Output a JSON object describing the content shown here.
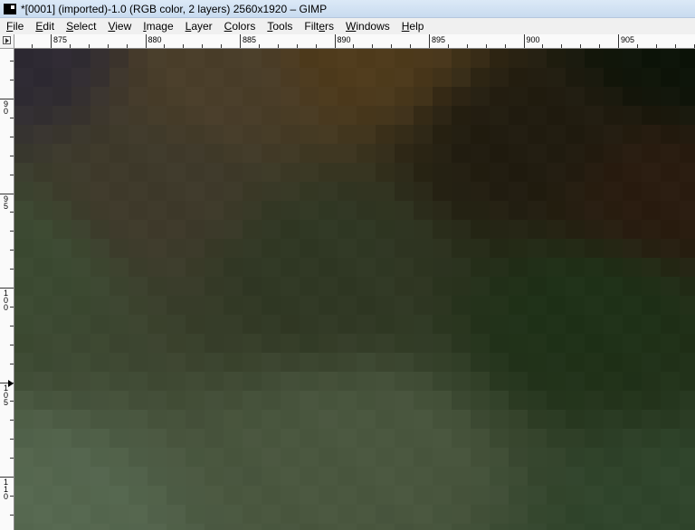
{
  "window": {
    "title": "*[0001] (imported)-1.0 (RGB color, 2 layers) 2560x1920 – GIMP"
  },
  "menu": [
    {
      "pre": "",
      "ul": "F",
      "post": "ile",
      "name": "file"
    },
    {
      "pre": "",
      "ul": "E",
      "post": "dit",
      "name": "edit"
    },
    {
      "pre": "",
      "ul": "S",
      "post": "elect",
      "name": "select"
    },
    {
      "pre": "",
      "ul": "V",
      "post": "iew",
      "name": "view"
    },
    {
      "pre": "",
      "ul": "I",
      "post": "mage",
      "name": "image"
    },
    {
      "pre": "",
      "ul": "L",
      "post": "ayer",
      "name": "layer"
    },
    {
      "pre": "",
      "ul": "C",
      "post": "olors",
      "name": "colors"
    },
    {
      "pre": "",
      "ul": "T",
      "post": "ools",
      "name": "tools"
    },
    {
      "pre": "Filt",
      "ul": "e",
      "post": "rs",
      "name": "filters"
    },
    {
      "pre": "",
      "ul": "W",
      "post": "indows",
      "name": "windows"
    },
    {
      "pre": "",
      "ul": "H",
      "post": "elp",
      "name": "help"
    }
  ],
  "rulers": {
    "horizontal_labels": [
      "875",
      "880",
      "885",
      "890",
      "895",
      "900",
      "905"
    ],
    "vertical_labels": [
      "90",
      "95",
      "100",
      "105",
      "110"
    ]
  },
  "canvas": {
    "description_colors": {
      "top_left": "#2e2a33",
      "top_mid": "#4a3e2a",
      "top_right": "#0d1409",
      "mid_center": "#303824",
      "right_mid": "#1f3118",
      "bottom_left": "#566850",
      "bottom_right": "#30452c"
    }
  }
}
